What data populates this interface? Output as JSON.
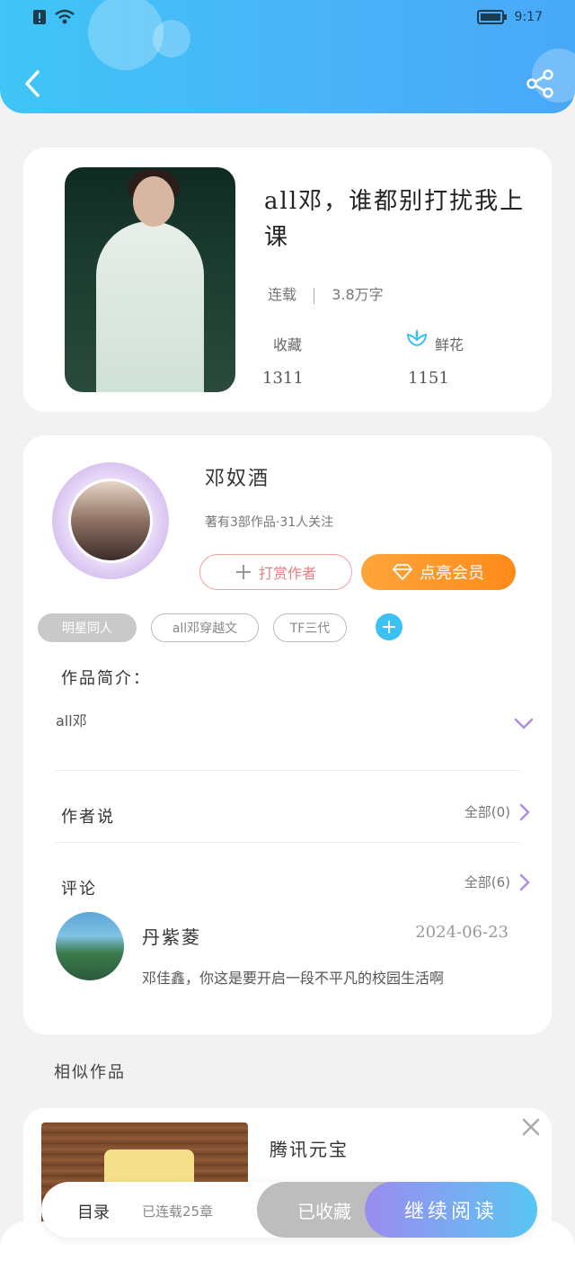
{
  "status_bar": {
    "time": "9:17"
  },
  "book": {
    "title": "all邓，谁都别打扰我上课",
    "status": "连载",
    "word_count": "3.8万字",
    "favorites_label": "收藏",
    "favorites_count": "1311",
    "flowers_label": "鲜花",
    "flowers_count": "1151"
  },
  "author": {
    "name": "邓奴酒",
    "stats": "著有3部作品·31人关注",
    "reward_label": "打赏作者",
    "vip_label": "点亮会员"
  },
  "tags": [
    "明星同人",
    "all邓穿越文",
    "TF三代"
  ],
  "intro": {
    "label": "作品简介：",
    "text": "all邓"
  },
  "author_says": {
    "label": "作者说",
    "all_label": "全部(0)"
  },
  "comments": {
    "label": "评论",
    "all_label": "全部(6)",
    "items": [
      {
        "name": "丹紫菱",
        "date": "2024-06-23",
        "text": "邓佳鑫，你这是要开启一段不平凡的校园生活啊"
      }
    ]
  },
  "similar": {
    "label": "相似作品",
    "items": [
      {
        "title": "腾讯元宝"
      }
    ]
  },
  "bottom_bar": {
    "directory": "目录",
    "chapters": "已连载25章",
    "favorited": "已收藏",
    "continue": "继续阅读"
  },
  "colors": {
    "header_start": "#3fc5f6",
    "header_end": "#48a8f8",
    "vip": "#ff8a1a",
    "read_start": "#9b8cf0",
    "read_end": "#59c6f3"
  }
}
